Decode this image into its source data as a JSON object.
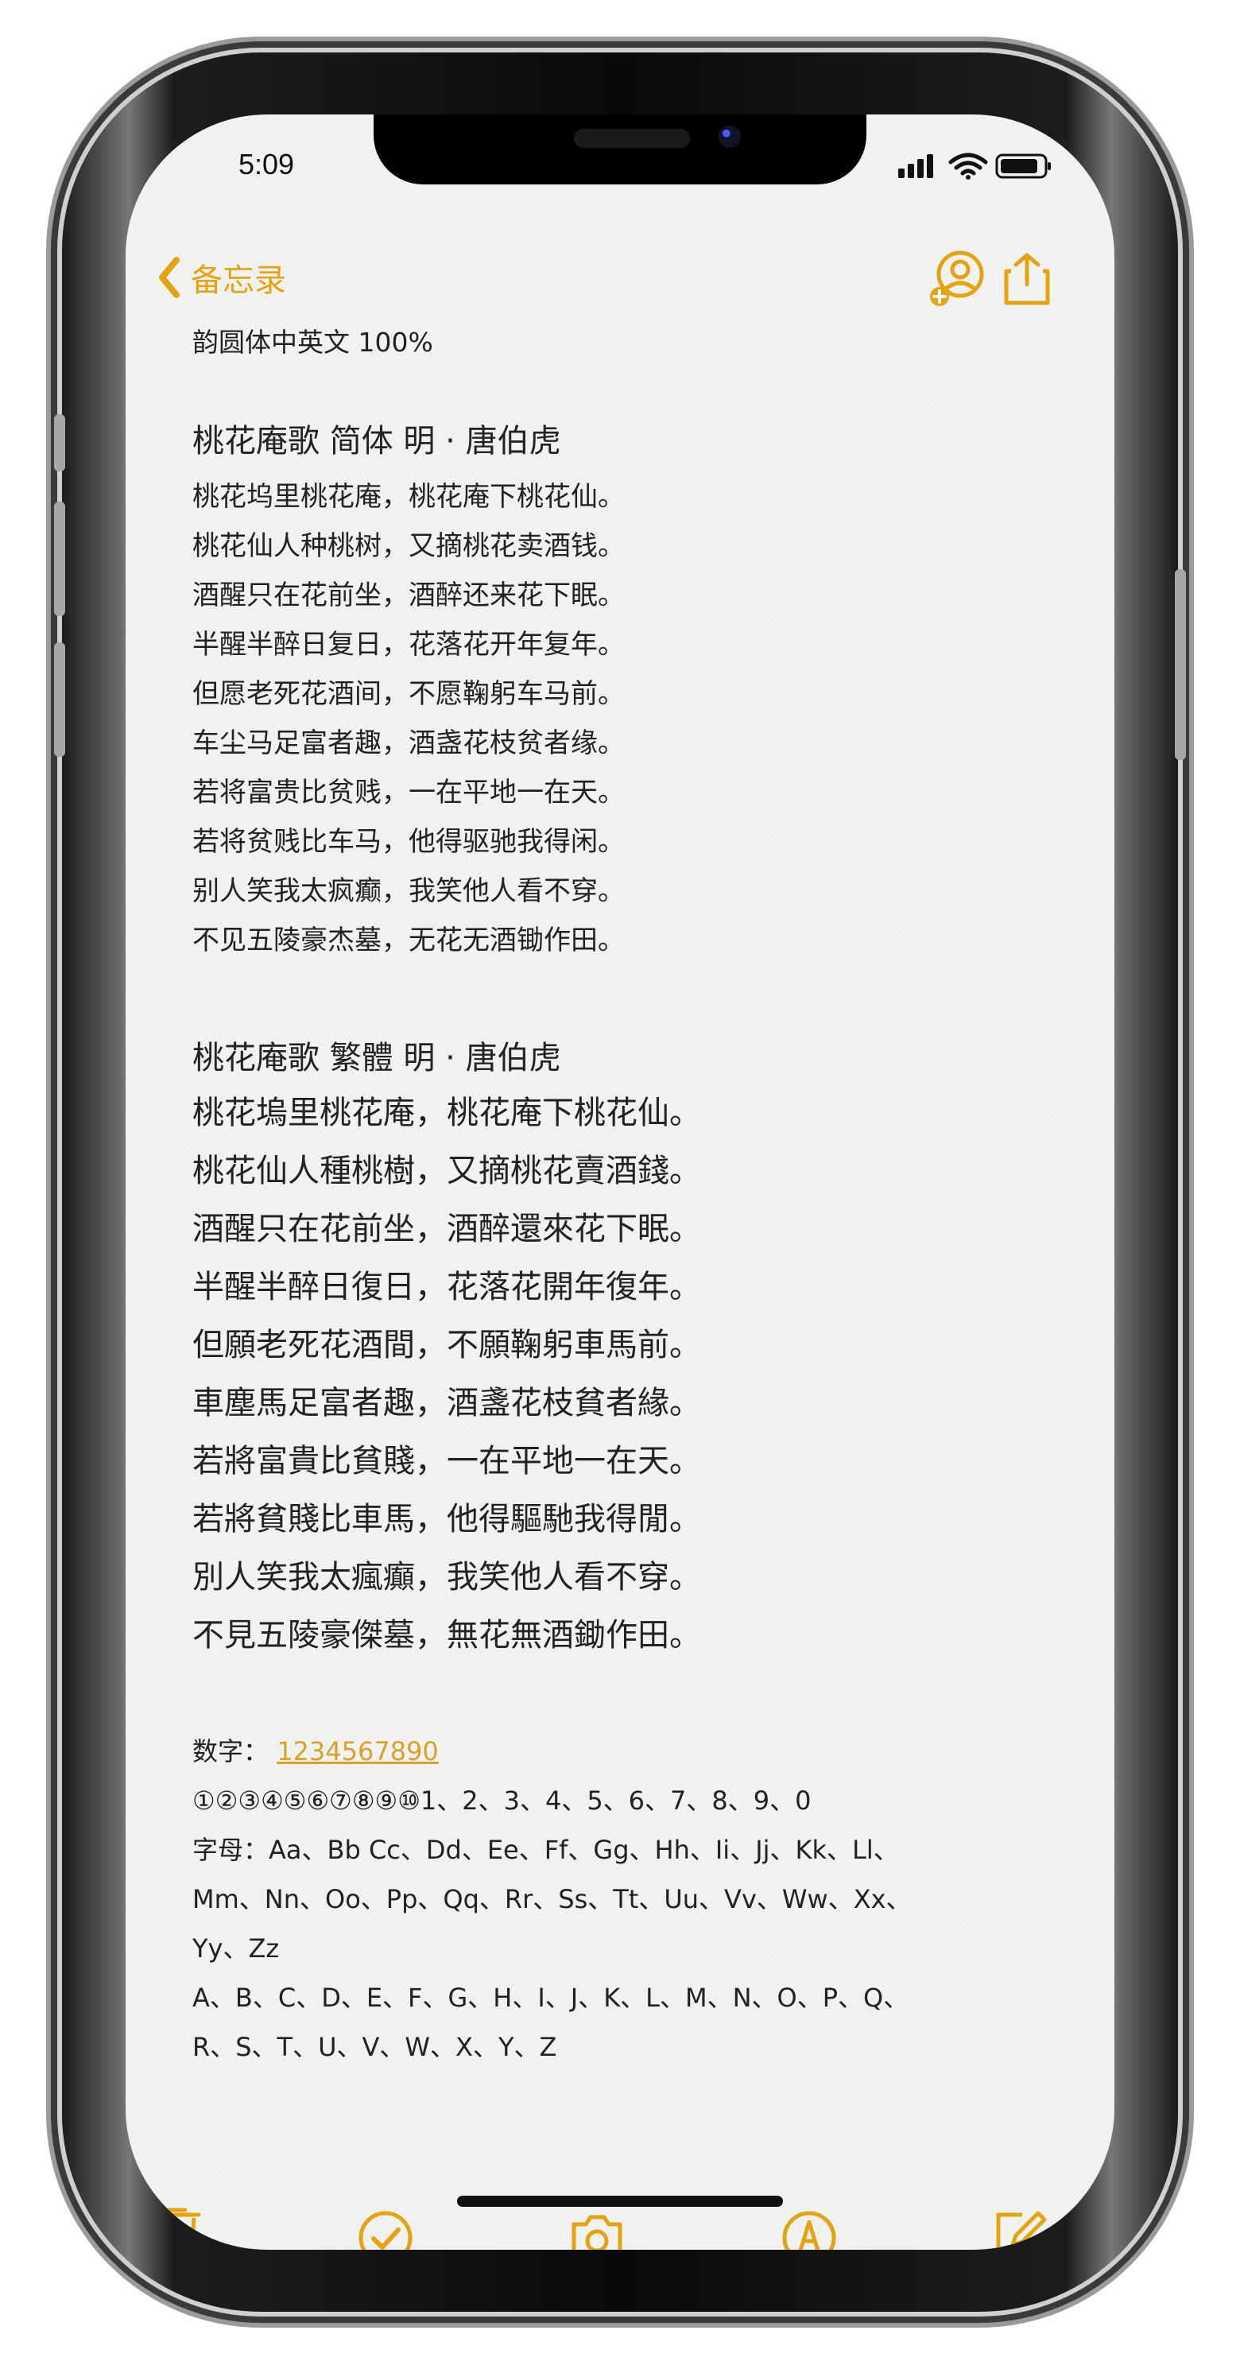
{
  "status": {
    "time": "5:09"
  },
  "nav": {
    "back_label": "备忘录"
  },
  "note": {
    "meta": "韵圆体中英文 100%",
    "section1_title": "桃花庵歌  简体    明 · 唐伯虎",
    "section1_lines": [
      "桃花坞里桃花庵，桃花庵下桃花仙。",
      "桃花仙人种桃树，又摘桃花卖酒钱。",
      "酒醒只在花前坐，酒醉还来花下眠。",
      "半醒半醉日复日，花落花开年复年。",
      "但愿老死花酒间，不愿鞠躬车马前。",
      "车尘马足富者趣，酒盏花枝贫者缘。",
      "若将富贵比贫贱，一在平地一在天。",
      "若将贫贱比车马，他得驱驰我得闲。",
      "别人笑我太疯癫，我笑他人看不穿。",
      "不见五陵豪杰墓，无花无酒锄作田。"
    ],
    "section2_title": "桃花庵歌  繁體      明 · 唐伯虎",
    "section2_lines": [
      "桃花塢里桃花庵，桃花庵下桃花仙。",
      "桃花仙人種桃樹，又摘桃花賣酒錢。",
      "酒醒只在花前坐，酒醉還來花下眠。",
      "半醒半醉日復日，花落花開年復年。",
      "但願老死花酒間，不願鞠躬車馬前。",
      "車塵馬足富者趣，酒盞花枝貧者緣。",
      "若將富貴比貧賤，一在平地一在天。",
      "若將貧賤比車馬，他得驅馳我得閒。",
      "別人笑我太瘋癲，我笑他人看不穿。",
      "不見五陵豪傑墓，無花無酒鋤作田。"
    ],
    "numbers_label": "数字：",
    "numbers_value": "1234567890",
    "circled_numbers": "①②③④⑤⑥⑦⑧⑨⑩1、2、3、4、5、6、7、8、9、0",
    "letters_line_1": "字母：Aa、Bb Cc、Dd、Ee、Ff、Gg、Hh、Ii、Jj、Kk、Ll、",
    "letters_line_2": "Mm、Nn、Oo、Pp、Qq、Rr、Ss、Tt、Uu、Vv、Ww、Xx、",
    "letters_line_3": "Yy、Zz",
    "caps_line_1": "A、B、C、D、E、F、G、H、I、J、K、L、M、N、O、P、Q、",
    "caps_line_2": "R、S、T、U、V、W、X、Y、Z"
  },
  "icons": {
    "back": "chevron-left-icon",
    "share_person": "person-add-icon",
    "share": "share-icon",
    "trash": "trash-icon",
    "check": "check-circle-icon",
    "camera": "camera-icon",
    "markup": "markup-icon",
    "compose": "compose-icon",
    "signal": "signal-icon",
    "wifi": "wifi-icon",
    "battery": "battery-icon"
  },
  "colors": {
    "accent": "#e2a315",
    "text": "#222222",
    "background": "#f4f4f2"
  }
}
